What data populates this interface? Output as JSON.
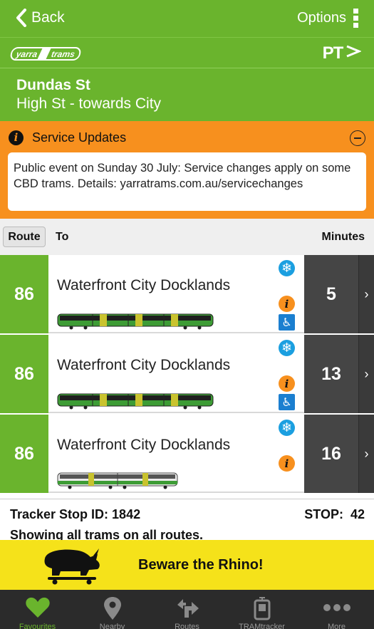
{
  "nav": {
    "back_label": "Back",
    "options_label": "Options"
  },
  "brand": {
    "logo_left": "yarra",
    "logo_right": "trams",
    "pt_logo": "PT"
  },
  "stop": {
    "name": "Dundas St",
    "direction": "High St - towards City"
  },
  "service_updates": {
    "title": "Service Updates",
    "message": "Public event on Sunday 30 July: Service changes apply on some CBD trams. Details: yarratrams.com.au/servicechanges"
  },
  "table": {
    "col_route": "Route",
    "col_to": "To",
    "col_minutes": "Minutes"
  },
  "arrivals": [
    {
      "route": "86",
      "destination": "Waterfront City Docklands",
      "minutes": "5",
      "tram_type": "e-class",
      "air_conditioned": true,
      "disruption_info": true,
      "low_floor": true
    },
    {
      "route": "86",
      "destination": "Waterfront City Docklands",
      "minutes": "13",
      "tram_type": "e-class",
      "air_conditioned": true,
      "disruption_info": true,
      "low_floor": true
    },
    {
      "route": "86",
      "destination": "Waterfront City Docklands",
      "minutes": "16",
      "tram_type": "b-class",
      "air_conditioned": true,
      "disruption_info": true,
      "low_floor": false
    }
  ],
  "footer": {
    "tracker_label": "Tracker Stop ID: 1842",
    "stop_label": "STOP:",
    "stop_number": "42",
    "showing_text": "Showing all trams on all routes."
  },
  "banner": {
    "text": "Beware the Rhino!"
  },
  "tabs": [
    {
      "label": "Favourites",
      "icon": "heart-icon",
      "active": true
    },
    {
      "label": "Nearby",
      "icon": "map-pin-icon",
      "active": false
    },
    {
      "label": "Routes",
      "icon": "route-arrows-icon",
      "active": false
    },
    {
      "label": "TRAMtracker",
      "icon": "tram-phone-icon",
      "active": false
    },
    {
      "label": "More",
      "icon": "more-dots-icon",
      "active": false
    }
  ],
  "colors": {
    "brand_green": "#6ab42d",
    "alert_orange": "#f7901e",
    "minutes_bg": "#454545",
    "banner_yellow": "#f5e21a",
    "tab_bg": "#2b2b2b"
  }
}
